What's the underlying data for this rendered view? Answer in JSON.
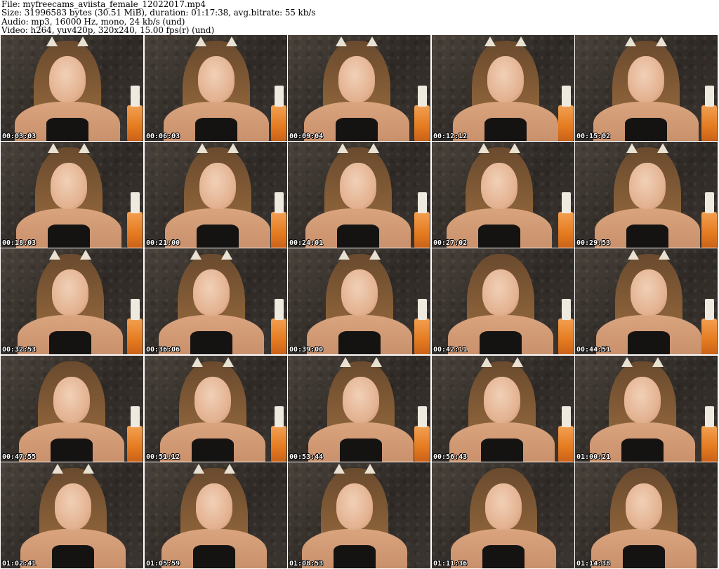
{
  "header": {
    "file_line": "File: myfreecams_aviista_female_12022017.mp4",
    "size_line": "Size: 31996583 bytes (30.51 MiB), duration: 01:17:38, avg.bitrate: 55 kb/s",
    "audio_line": "Audio: mp3, 16000 Hz, mono, 24 kb/s (und)",
    "video_line": "Video: h264, yuv420p, 320x240, 15.00 fps(r) (und)"
  },
  "thumbnails": [
    {
      "timestamp": "00:03:03",
      "ears": true,
      "bottle": true
    },
    {
      "timestamp": "00:06:03",
      "ears": true,
      "bottle": true
    },
    {
      "timestamp": "00:09:04",
      "ears": true,
      "bottle": true
    },
    {
      "timestamp": "00:12:12",
      "ears": true,
      "bottle": true
    },
    {
      "timestamp": "00:15:02",
      "ears": true,
      "bottle": true
    },
    {
      "timestamp": "00:18:03",
      "ears": true,
      "bottle": true
    },
    {
      "timestamp": "00:21:00",
      "ears": true,
      "bottle": true
    },
    {
      "timestamp": "00:24:01",
      "ears": true,
      "bottle": true
    },
    {
      "timestamp": "00:27:02",
      "ears": true,
      "bottle": true
    },
    {
      "timestamp": "00:29:53",
      "ears": true,
      "bottle": true
    },
    {
      "timestamp": "00:32:53",
      "ears": true,
      "bottle": true
    },
    {
      "timestamp": "00:36:06",
      "ears": true,
      "bottle": true
    },
    {
      "timestamp": "00:39:00",
      "ears": true,
      "bottle": true
    },
    {
      "timestamp": "00:42:11",
      "ears": false,
      "bottle": true
    },
    {
      "timestamp": "00:44:51",
      "ears": true,
      "bottle": true
    },
    {
      "timestamp": "00:47:55",
      "ears": false,
      "bottle": true
    },
    {
      "timestamp": "00:51:12",
      "ears": true,
      "bottle": true
    },
    {
      "timestamp": "00:53:44",
      "ears": true,
      "bottle": true
    },
    {
      "timestamp": "00:56:43",
      "ears": true,
      "bottle": true
    },
    {
      "timestamp": "01:00:21",
      "ears": true,
      "bottle": true
    },
    {
      "timestamp": "01:02:41",
      "ears": true,
      "bottle": false
    },
    {
      "timestamp": "01:05:59",
      "ears": true,
      "bottle": false
    },
    {
      "timestamp": "01:08:53",
      "ears": true,
      "bottle": false
    },
    {
      "timestamp": "01:11:36",
      "ears": false,
      "bottle": false
    },
    {
      "timestamp": "01:14:38",
      "ears": false,
      "bottle": false
    }
  ]
}
